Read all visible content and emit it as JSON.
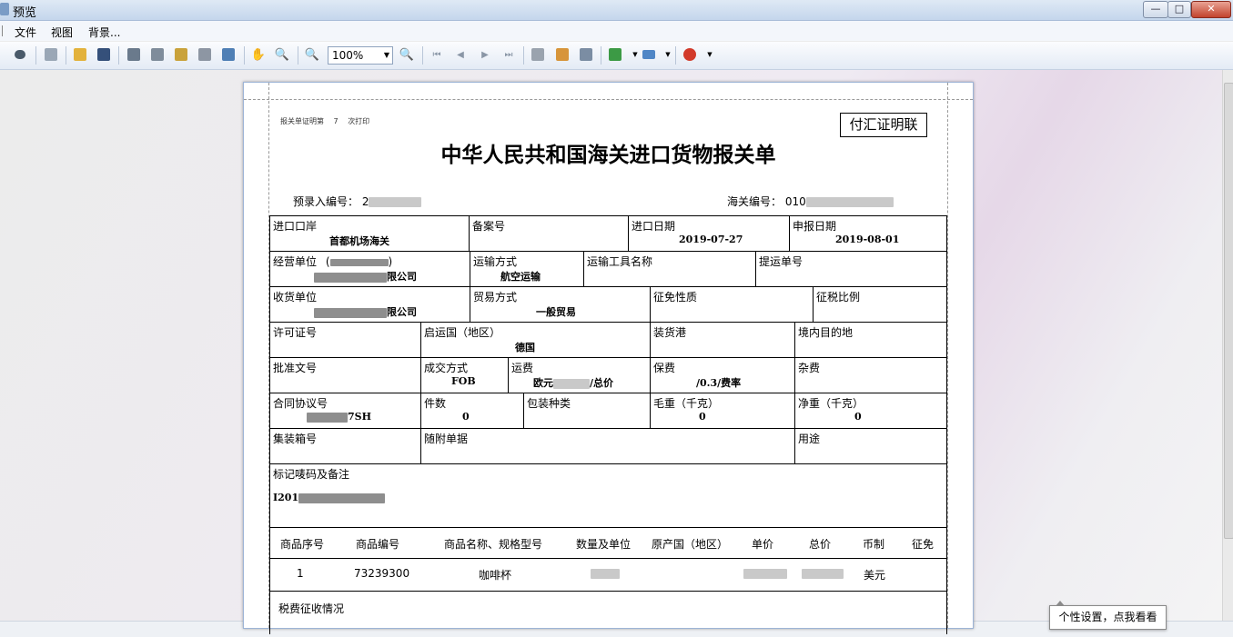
{
  "window": {
    "title": "预览",
    "caption": "",
    "minimize": "—",
    "maximize": "□",
    "close": "✕"
  },
  "menu": {
    "file": "文件",
    "view": "视图",
    "background": "背景..."
  },
  "toolbar": {
    "zoom_value": "100%",
    "icons": [
      "find-icon",
      "page-setup-icon",
      "open-icon",
      "save-icon",
      "print-setup-icon",
      "print-icon",
      "quick-print-icon",
      "scale-icon",
      "page-layout-icon",
      "hand-tool-icon",
      "magnifier-icon",
      "zoom-out-icon",
      "zoom-in-icon",
      "first-page-icon",
      "prev-page-icon",
      "next-page-icon",
      "last-page-icon",
      "multi-page-icon",
      "color-icon",
      "watermark-icon",
      "export-icon",
      "email-icon",
      "close-preview-icon"
    ]
  },
  "doc": {
    "print_note_prefix": "报关单证明第",
    "print_note_count": "7",
    "print_note_suffix": "次打印",
    "stamp": "付汇证明联",
    "title": "中华人民共和国海关进口货物报关单",
    "pre_entry_label": "预录入编号：",
    "pre_entry_value": "2",
    "customs_no_label": "海关编号：",
    "customs_no_value": "010"
  },
  "form": {
    "import_port_label": "进口口岸",
    "import_port_value": "首都机场海关",
    "record_no_label": "备案号",
    "import_date_label": "进口日期",
    "import_date_value": "2019-07-27",
    "declare_date_label": "申报日期",
    "declare_date_value": "2019-08-01",
    "operator_label": "经营单位",
    "operator_paren_open": "(",
    "operator_paren_close": ")",
    "operator_value_suffix": "限公司",
    "transport_label": "运输方式",
    "transport_value": "航空运输",
    "vehicle_label": "运输工具名称",
    "bl_label": "提运单号",
    "consignee_label": "收货单位",
    "consignee_value_suffix": "限公司",
    "trade_label": "贸易方式",
    "trade_value": "一般贸易",
    "exemption_label": "征免性质",
    "tax_ratio_label": "征税比例",
    "license_label": "许可证号",
    "origin_country_label": "启运国（地区）",
    "origin_country_value": "德国",
    "loading_port_label": "装货港",
    "destination_label": "境内目的地",
    "approval_label": "批准文号",
    "deal_label": "成交方式",
    "deal_value": "FOB",
    "freight_label": "运费",
    "freight_value_prefix": "欧元",
    "freight_value_suffix": "/总价",
    "insurance_label": "保费",
    "insurance_value": "/0.3/费率",
    "misc_label": "杂费",
    "contract_label": "合同协议号",
    "contract_value_suffix": "7SH",
    "packages_label": "件数",
    "packages_value": "0",
    "package_type_label": "包装种类",
    "gross_label": "毛重（千克）",
    "gross_value": "0",
    "net_label": "净重（千克）",
    "net_value": "0",
    "container_label": "集装箱号",
    "documents_label": "随附单据",
    "usage_label": "用途",
    "marks_label": "标记唛码及备注",
    "marks_value": "I201"
  },
  "goods": {
    "headers": [
      "商品序号",
      "商品编号",
      "商品名称、规格型号",
      "数量及单位",
      "原产国（地区）",
      "单价",
      "总价",
      "币制",
      "征免"
    ],
    "rows": [
      {
        "seq": "1",
        "code": "73239300",
        "name": "咖啡杯",
        "currency": "美元"
      }
    ],
    "tax_label": "税费征收情况"
  },
  "tooltip": "个性设置，点我看看"
}
